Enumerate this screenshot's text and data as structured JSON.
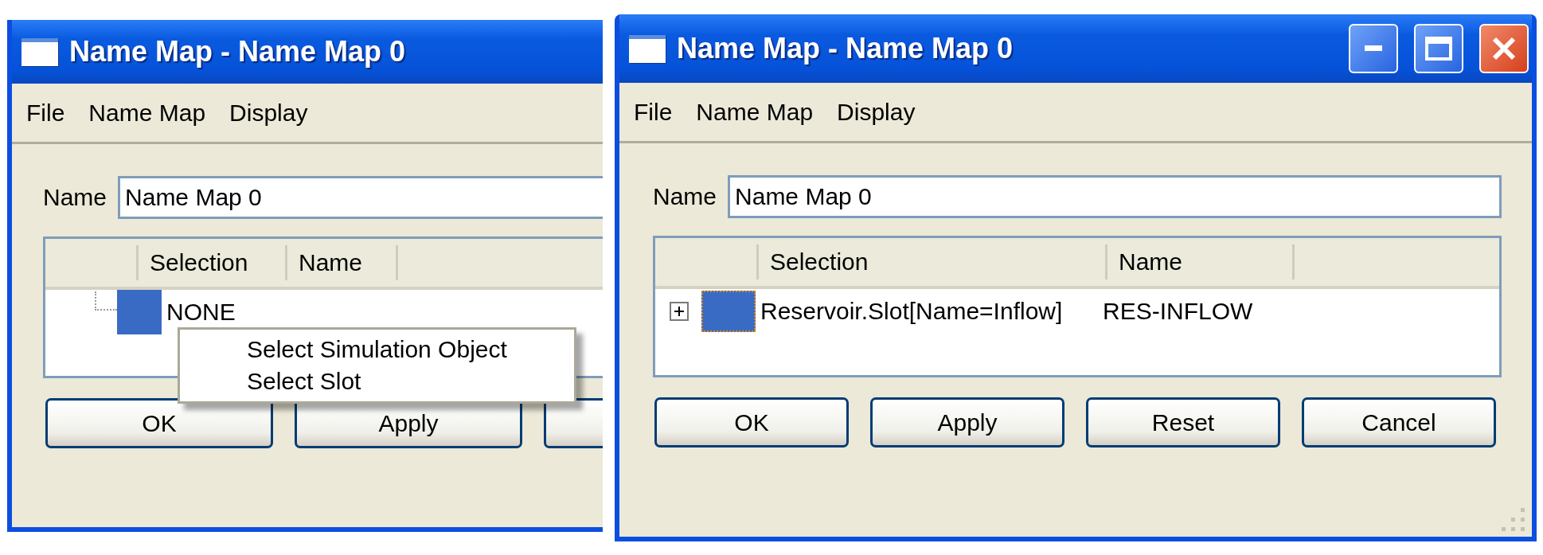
{
  "windows": [
    {
      "title": "Name Map - Name Map 0",
      "clipped": true,
      "menu": [
        "File",
        "Name Map",
        "Display"
      ],
      "name_label": "Name",
      "name_value": "Name Map 0",
      "columns": [
        "Selection",
        "Name"
      ],
      "rows": [
        {
          "selection": "NONE",
          "color": "#3a6bc4",
          "focused": false
        }
      ],
      "buttons": [
        {
          "kind": "button",
          "label": "OK"
        },
        {
          "kind": "button",
          "label": "Apply"
        },
        {
          "kind": "cut"
        }
      ],
      "context_menu": {
        "items": [
          "Select Simulation Object",
          "Select Slot"
        ]
      }
    },
    {
      "title": "Name Map - Name Map 0",
      "clipped": false,
      "menu": [
        "File",
        "Name Map",
        "Display"
      ],
      "name_label": "Name",
      "name_value": "Name Map 0",
      "columns": [
        "Selection",
        "Name"
      ],
      "rows": [
        {
          "selection": "Reservoir.Slot[Name=Inflow]",
          "name": "RES-INFLOW",
          "color": "#3a6bc4",
          "focused": true,
          "expanded": false
        }
      ],
      "buttons": [
        {
          "kind": "button",
          "label": "OK"
        },
        {
          "kind": "button",
          "label": "Apply"
        },
        {
          "kind": "button",
          "label": "Reset"
        },
        {
          "kind": "button",
          "label": "Cancel"
        }
      ]
    }
  ]
}
